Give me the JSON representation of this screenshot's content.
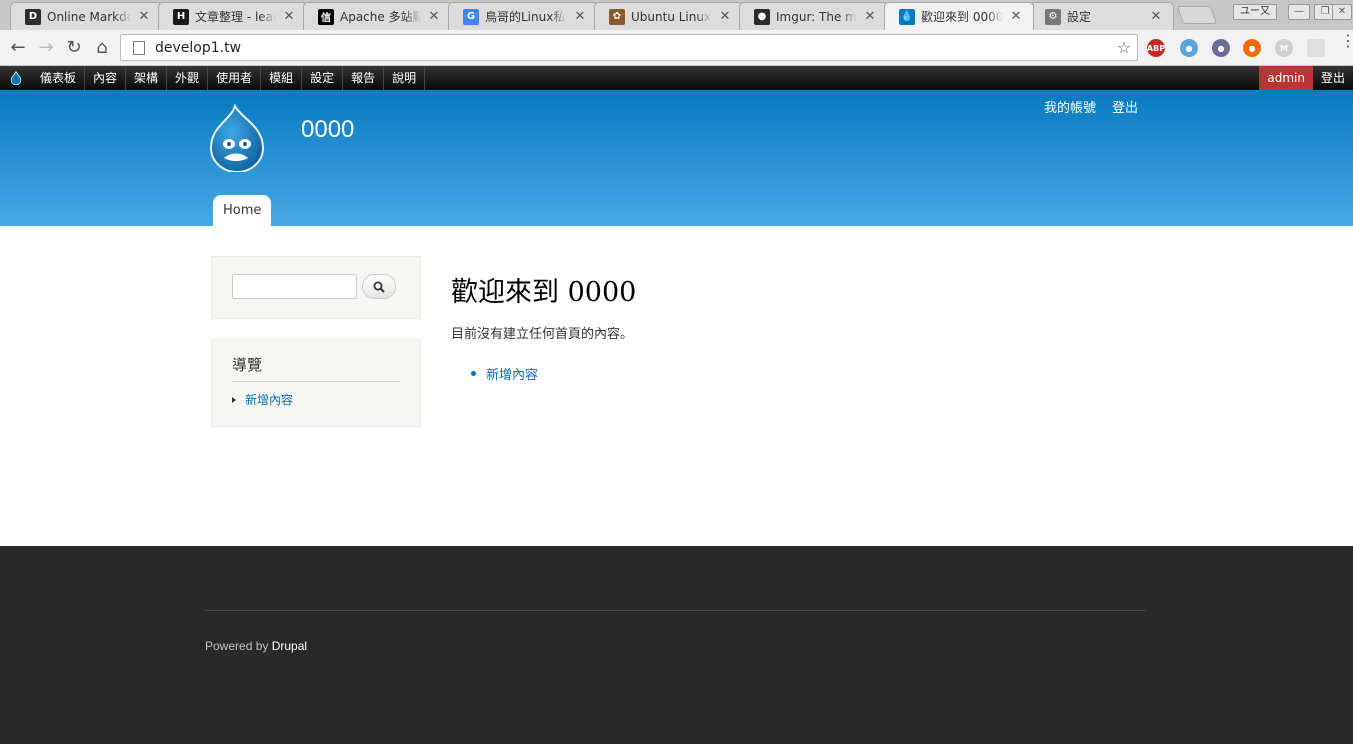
{
  "browser": {
    "tabs": [
      {
        "title": "Online Markdown Editor",
        "favicon_text": "D",
        "favicon_color": "#2d2d2d",
        "active": false
      },
      {
        "title": "文章整理 - learning",
        "favicon_text": "H",
        "favicon_color": "#1a1a1a",
        "active": false
      },
      {
        "title": "Apache 多站點設定",
        "favicon_text": "信",
        "favicon_color": "#000000",
        "active": false
      },
      {
        "title": "鳥哥的Linux私房菜",
        "favicon_text": "G",
        "favicon_color": "#4285f4",
        "active": false
      },
      {
        "title": "Ubuntu Linux環境",
        "favicon_text": "✿",
        "favicon_color": "#8a5a2b",
        "active": false
      },
      {
        "title": "Imgur: The most awesome",
        "favicon_text": "●",
        "favicon_color": "#2b2b2b",
        "active": false
      },
      {
        "title": "歡迎來到 0000",
        "favicon_text": "💧",
        "favicon_color": "#0678be",
        "active": true
      },
      {
        "title": "設定",
        "favicon_text": "⚙",
        "favicon_color": "#777777",
        "active": false
      }
    ],
    "profile_label": "ユー又",
    "url": "develop1.tw"
  },
  "admin_toolbar": {
    "items": [
      "儀表板",
      "內容",
      "架構",
      "外觀",
      "使用者",
      "模組",
      "設定",
      "報告",
      "說明"
    ],
    "user": "admin",
    "logout": "登出"
  },
  "header": {
    "site_name": "0000",
    "secondary_menu": [
      "我的帳號",
      "登出"
    ],
    "main_menu_tab": "Home"
  },
  "sidebar": {
    "nav_title": "導覽",
    "nav_item": "新增內容"
  },
  "content": {
    "title": "歡迎來到 0000",
    "intro": "目前沒有建立任何首頁的內容。",
    "list_item": "新增內容"
  },
  "footer": {
    "powered_prefix": "Powered by",
    "powered_brand": "Drupal"
  },
  "colors": {
    "header_top": "#0779bf",
    "header_bottom": "#48a9e4",
    "link": "#0071b3",
    "footer_bg": "#292929",
    "admin_user_bg": "#bb3333"
  }
}
